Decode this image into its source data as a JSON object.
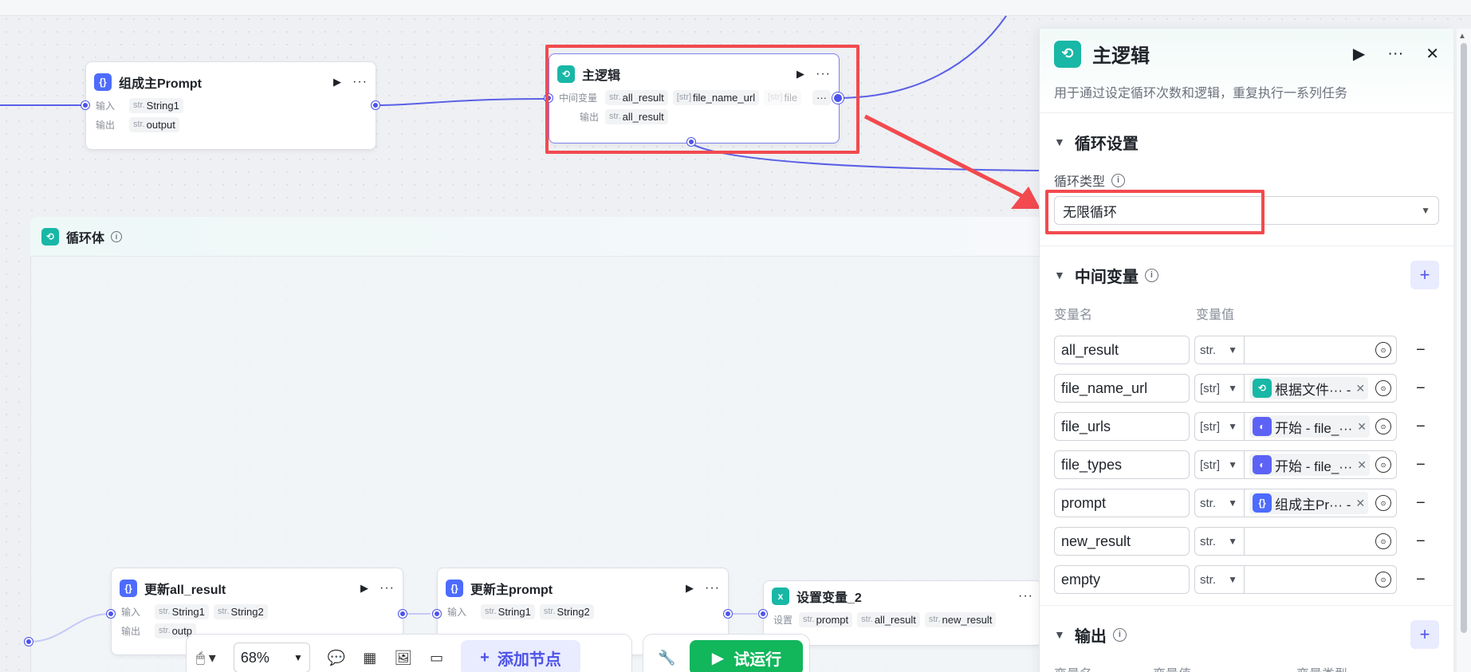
{
  "nodes": {
    "compose_prompt": {
      "title": "组成主Prompt",
      "input_label": "输入",
      "input_type": "str.",
      "input_value": "String1",
      "output_label": "输出",
      "output_type": "str.",
      "output_value": "output"
    },
    "main_logic": {
      "title": "主逻辑",
      "mid_label": "中间变量",
      "mid_vars": [
        {
          "type": "str.",
          "name": "all_result"
        },
        {
          "type": "[str]",
          "name": "file_name_url"
        },
        {
          "type": "[str]",
          "name": "file"
        }
      ],
      "output_label": "输出",
      "output_type": "str.",
      "output_value": "all_result"
    },
    "loop_body": {
      "title": "循环体"
    },
    "update_all_result": {
      "title": "更新all_result",
      "input_label": "输入",
      "inputs": [
        {
          "type": "str.",
          "name": "String1"
        },
        {
          "type": "str.",
          "name": "String2"
        }
      ],
      "output_label": "输出",
      "output_type": "str.",
      "output_value": "outp"
    },
    "update_main_prompt": {
      "title": "更新主prompt",
      "input_label": "输入",
      "inputs": [
        {
          "type": "str.",
          "name": "String1"
        },
        {
          "type": "str.",
          "name": "String2"
        }
      ]
    },
    "set_var_2": {
      "title": "设置变量_2",
      "set_label": "设置",
      "vars": [
        {
          "type": "str.",
          "name": "prompt"
        },
        {
          "type": "str.",
          "name": "all_result"
        },
        {
          "type": "str.",
          "name": "new_result"
        }
      ]
    }
  },
  "panel": {
    "title": "主逻辑",
    "description": "用于通过设定循环次数和逻辑，重复执行一系列任务",
    "loop_settings": {
      "title": "循环设置",
      "type_label": "循环类型",
      "type_value": "无限循环"
    },
    "mid_vars": {
      "title": "中间变量",
      "col_name": "变量名",
      "col_value": "变量值",
      "rows": [
        {
          "name": "all_result",
          "type": "str.",
          "ref": "",
          "ref_icon": ""
        },
        {
          "name": "file_name_url",
          "type": "[str]",
          "ref": "根据文件··· -",
          "ref_icon": "loop"
        },
        {
          "name": "file_urls",
          "type": "[str]",
          "ref": "开始 - file_···",
          "ref_icon": "start"
        },
        {
          "name": "file_types",
          "type": "[str]",
          "ref": "开始 - file_···",
          "ref_icon": "start"
        },
        {
          "name": "prompt",
          "type": "str.",
          "ref": "组成主Pr··· -",
          "ref_icon": "code"
        },
        {
          "name": "new_result",
          "type": "str.",
          "ref": "",
          "ref_icon": ""
        },
        {
          "name": "empty",
          "type": "str.",
          "ref": "",
          "ref_icon": ""
        }
      ]
    },
    "output": {
      "title": "输出",
      "col_name": "变量名",
      "col_value": "变量值",
      "col_type": "变量类型"
    }
  },
  "toolbar": {
    "zoom": "68%",
    "add_node": "添加节点",
    "test_run": "试运行"
  },
  "colors": {
    "accent": "#4d53e8",
    "teal": "#18b7a6",
    "run_green": "#12b65b",
    "highlight_red": "#f24a4f"
  }
}
